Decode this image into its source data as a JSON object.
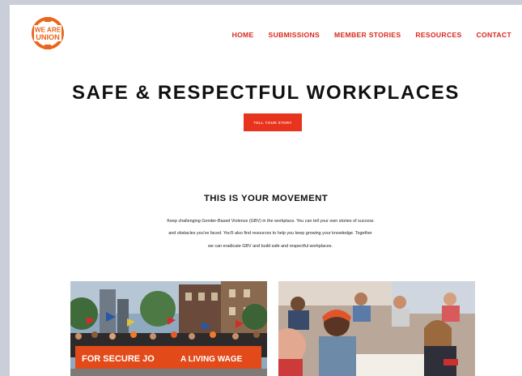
{
  "logo": {
    "line1": "WE ARE",
    "line2": "UNION",
    "color": "#e9661c"
  },
  "nav": {
    "items": [
      {
        "label": "HOME"
      },
      {
        "label": "SUBMISSIONS"
      },
      {
        "label": "MEMBER STORIES"
      },
      {
        "label": "RESOURCES"
      },
      {
        "label": "CONTACT"
      }
    ],
    "color": "#d9261c"
  },
  "hero": {
    "title": "SAFE & RESPECTFUL WORKPLACES",
    "cta_label": "TELL YOUR STORY",
    "cta_color": "#e8341f"
  },
  "movement": {
    "title": "THIS IS YOUR MOVEMENT",
    "lines": [
      "Keep challenging Gender-Based Violence (GBV) in the workplace. You can tell your own stories of success",
      "and obstacles you've faced. You'll also find resources to help you keep growing your knowledge. Together",
      "we can eradicate GBV and build safe and respectful workplaces."
    ]
  },
  "photos": {
    "left_banner_left": "FOR SECURE JO",
    "left_banner_right": "A LIVING WAGE"
  }
}
